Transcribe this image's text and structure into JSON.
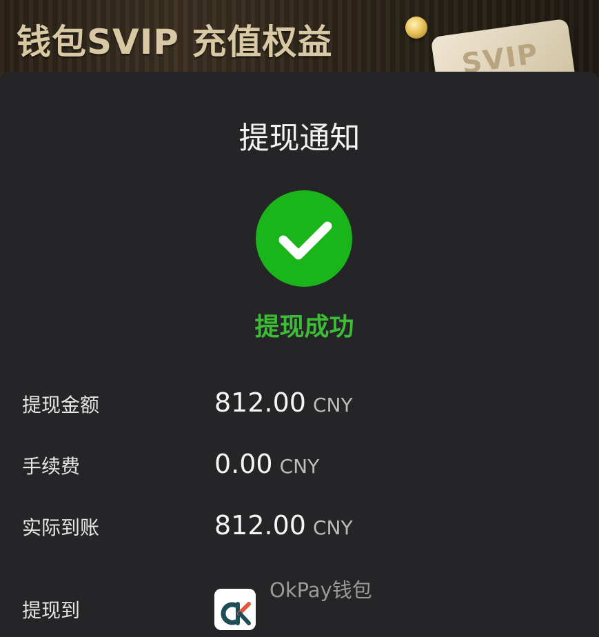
{
  "banner": {
    "title": "钱包SVIP 充值权益",
    "card_text": "SVIP"
  },
  "dialog": {
    "title": "提现通知",
    "status": "提现成功",
    "status_color": "#3bbd35",
    "success_icon": "checkmark-circle-icon",
    "rows": [
      {
        "label": "提现金额",
        "amount": "812.00",
        "currency": "CNY"
      },
      {
        "label": "手续费",
        "amount": "0.00",
        "currency": "CNY"
      },
      {
        "label": "实际到账",
        "amount": "812.00",
        "currency": "CNY"
      }
    ],
    "destination": {
      "label": "提现到",
      "name": "OkPay钱包",
      "logo_icon": "okpay-logo-icon"
    }
  },
  "colors": {
    "background": "#252527",
    "success_green": "#1ab51a",
    "text_primary": "#f5f5f5",
    "text_secondary": "#bdbdbd"
  }
}
